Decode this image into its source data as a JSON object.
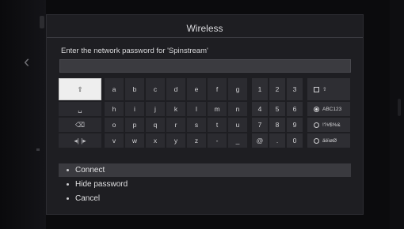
{
  "dialog": {
    "title": "Wireless",
    "prompt": "Enter the network password for 'Spinstream'",
    "password_value": ""
  },
  "keyboard": {
    "function_keys": [
      {
        "name": "shift-key",
        "label": "⇧"
      },
      {
        "name": "space-key",
        "label": "␣"
      },
      {
        "name": "backspace-key",
        "label": "⌫"
      },
      {
        "name": "cursor-keys",
        "label": "◂|   |▸"
      }
    ],
    "letter_rows": [
      [
        "a",
        "b",
        "c",
        "d",
        "e",
        "f",
        "g"
      ],
      [
        "h",
        "i",
        "j",
        "k",
        "l",
        "m",
        "n"
      ],
      [
        "o",
        "p",
        "q",
        "r",
        "s",
        "t",
        "u"
      ],
      [
        "v",
        "w",
        "x",
        "y",
        "z",
        "-",
        "_"
      ]
    ],
    "number_rows": [
      [
        "1",
        "2",
        "3"
      ],
      [
        "4",
        "5",
        "6"
      ],
      [
        "7",
        "8",
        "9"
      ],
      [
        "@",
        ".",
        "0"
      ]
    ],
    "mode_options": [
      {
        "label": "⇧",
        "type": "checkbox"
      },
      {
        "label": "ABC123",
        "type": "radio",
        "selected": true
      },
      {
        "label": "!?#$%&",
        "type": "radio",
        "selected": false
      },
      {
        "label": "äëìøØ",
        "type": "radio",
        "selected": false
      }
    ]
  },
  "menu": {
    "items": [
      {
        "label": "Connect",
        "active": true
      },
      {
        "label": "Hide password",
        "active": false
      },
      {
        "label": "Cancel",
        "active": false
      }
    ]
  }
}
